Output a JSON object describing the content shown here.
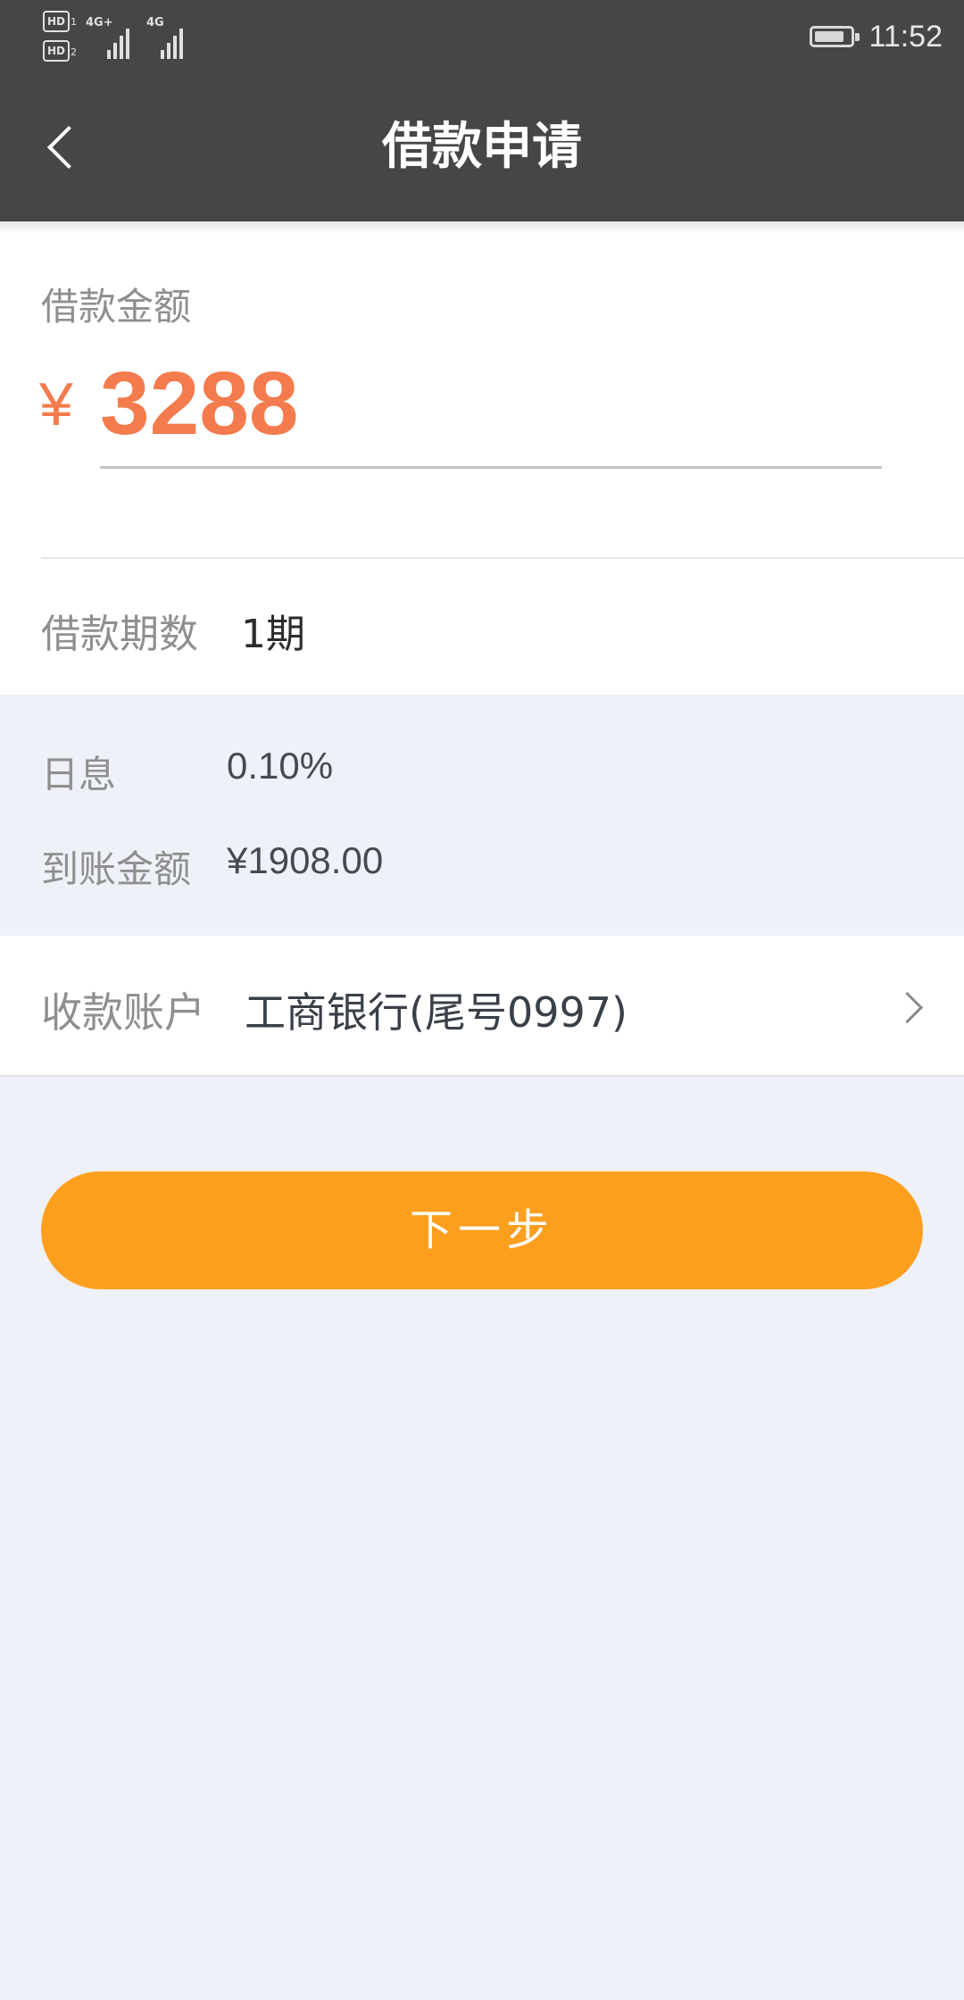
{
  "status_bar": {
    "sim1_badge": "HD",
    "sim1_index": "1",
    "sim2_badge": "HD",
    "sim2_index": "2",
    "network1": "4G+",
    "network2": "4G",
    "time": "11:52",
    "battery_level": 0.8
  },
  "header": {
    "title": "借款申请",
    "back_icon": "chevron-left-icon"
  },
  "loan": {
    "amount_label": "借款金额",
    "currency_symbol": "¥",
    "amount": "3288",
    "term_label": "借款期数",
    "term_value": "1期"
  },
  "info": {
    "daily_rate_label": "日息",
    "daily_rate_value": "0.10%",
    "arrival_amount_label": "到账金额",
    "arrival_amount_value": "¥1908.00"
  },
  "account": {
    "label": "收款账户",
    "value": "工商银行(尾号0997)",
    "chevron_icon": "chevron-right-icon"
  },
  "actions": {
    "next_label": "下一步"
  },
  "colors": {
    "header_bg": "#464646",
    "accent_amount": "#f47b4d",
    "primary_button": "#fd9f1e",
    "page_bg": "#eef1f8"
  }
}
